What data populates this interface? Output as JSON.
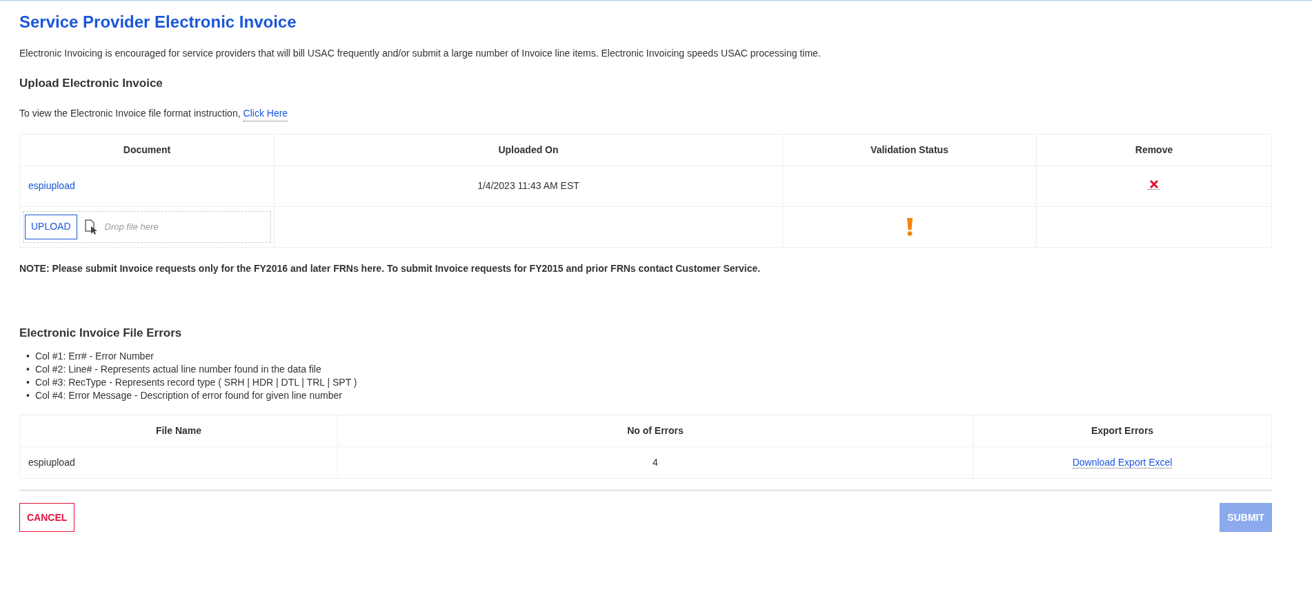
{
  "title": "Service Provider Electronic Invoice",
  "intro": "Electronic Invoicing is encouraged for service providers that will bill USAC frequently and/or submit a large number of Invoice line items. Electronic Invoicing speeds USAC processing time.",
  "upload_section": {
    "heading": "Upload Electronic Invoice",
    "instruction": "To view the Electronic Invoice file format instruction,",
    "link": "Click Here"
  },
  "upload_table": {
    "columns": [
      "Document",
      "Uploaded On",
      "Validation Status",
      "Remove"
    ],
    "rows": [
      {
        "document": "espiupload",
        "uploaded_on": "1/4/2023 11:43 AM EST"
      }
    ],
    "upload_row": {
      "button": "UPLOAD",
      "placeholder": "Drop file here"
    }
  },
  "note": "NOTE: Please submit Invoice requests only for the FY2016 and later FRNs here. To submit Invoice requests for FY2015 and prior FRNs contact Customer Service.",
  "errors_section": {
    "heading": "Electronic Invoice File Errors",
    "items": [
      {
        "bullet": "•",
        "text": "Col #1: Err# - Error Number"
      },
      {
        "bullet": "•",
        "text": "Col #2: Line# - Represents actual line number found in the data file"
      },
      {
        "bullet": "•",
        "text": "Col #3: RecType - Represents record type ( SRH | HDR | DTL | TRL | SPT )"
      },
      {
        "bullet": "•",
        "text": "Col #4: Error Message - Description of error found for given line number"
      }
    ]
  },
  "errors_table": {
    "columns": [
      "File Name",
      "No of Errors",
      "Export Errors"
    ],
    "rows": [
      {
        "file_name": "espiupload",
        "errors": "4",
        "export": "Download Export Excel"
      }
    ]
  },
  "buttons": [
    {
      "label": "CANCEL",
      "kind": "cancel",
      "disabled": false
    },
    {
      "label": "SUBMIT",
      "kind": "submit",
      "disabled": true
    }
  ]
}
